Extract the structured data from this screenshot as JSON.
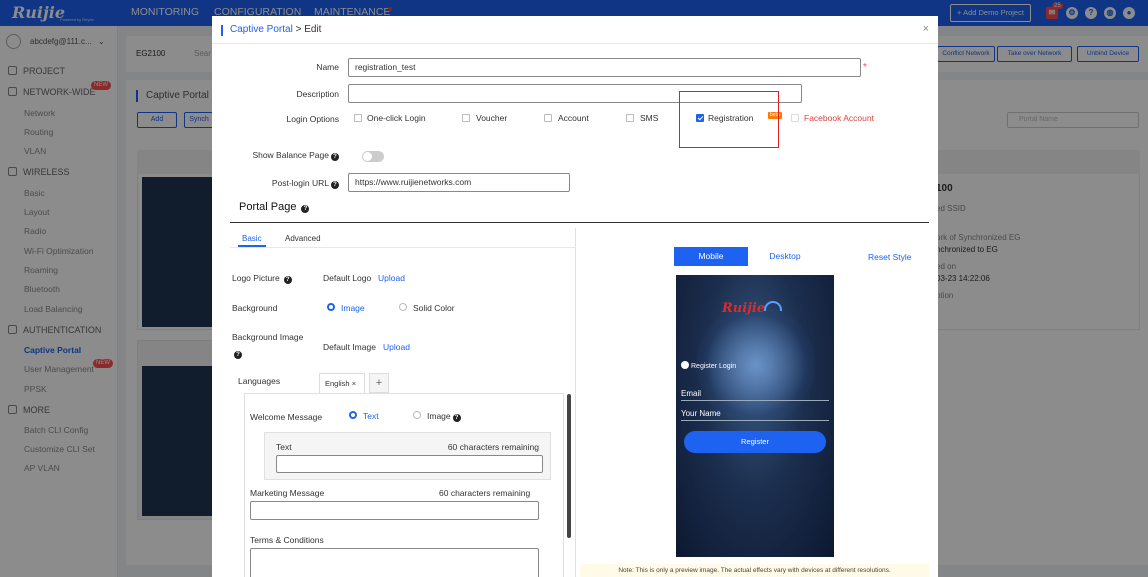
{
  "topbar": {
    "logo": "Ruijie",
    "logo_sub": "Powered by Reyee",
    "nav": [
      "MONITORING",
      "CONFIGURATION",
      "MAINTENANCE"
    ],
    "demo_button": "+ Add Demo Project",
    "notif_count": "25"
  },
  "sidebar": {
    "user": "abcdefg@111.c...",
    "sections": [
      {
        "label": "PROJECT"
      },
      {
        "label": "NETWORK-WIDE",
        "badge": "NEW"
      },
      {
        "label": "WIRELESS"
      },
      {
        "label": "AUTHENTICATION"
      },
      {
        "label": "MORE"
      }
    ],
    "items": [
      "Network",
      "Routing",
      "VLAN",
      "Basic",
      "Layout",
      "Radio",
      "Wi-Fi Optimization",
      "Roaming",
      "Bluetooth",
      "Load Balancing",
      "Captive Portal",
      "User Management",
      "PPSK",
      "Batch CLI Config",
      "Customize CLI Set",
      "AP VLAN"
    ],
    "user_mgmt_badge": "NEW"
  },
  "background": {
    "device": "EG2100",
    "search_stub": "Sear",
    "page_title": "Captive Portal",
    "add_button": "Add",
    "sync_stub": "Synch",
    "header_buttons": [
      "Conflict Network",
      "Take over Network",
      "Unbind Device"
    ],
    "portal_search_placeholder": "Portal Name",
    "card_title_stub": "100",
    "card_lines": [
      "ed SSID",
      "ork of Synchronized EG",
      "nchronized to EG",
      "ed on",
      "03-23 14:22:06",
      "ption"
    ]
  },
  "modal": {
    "breadcrumb": "Captive Portal",
    "title": "Edit",
    "name_label": "Name",
    "name_value": "registration_test",
    "description_label": "Description",
    "description_value": "",
    "login_options_label": "Login Options",
    "login_options": [
      {
        "label": "One-click Login",
        "checked": false
      },
      {
        "label": "Voucher",
        "checked": false
      },
      {
        "label": "Account",
        "checked": false
      },
      {
        "label": "SMS",
        "checked": false
      },
      {
        "label": "Registration",
        "checked": true
      },
      {
        "label": "Facebook Account",
        "checked": false
      }
    ],
    "beta_badge": "beta",
    "show_balance_label": "Show Balance Page",
    "post_login_label": "Post-login URL",
    "post_login_value": "https://www.ruijienetworks.com",
    "portal_page_title": "Portal Page",
    "tabs": [
      "Basic",
      "Advanced"
    ],
    "logo_picture_label": "Logo Picture",
    "default_logo": "Default Logo",
    "upload": "Upload",
    "background_label": "Background",
    "background_options": [
      "Image",
      "Solid Color"
    ],
    "background_image_label": "Background Image",
    "default_image": "Default Image",
    "languages_label": "Languages",
    "language_tab": "English",
    "welcome_label": "Welcome Message",
    "welcome_options": [
      "Text",
      "Image"
    ],
    "text_label": "Text",
    "text_remaining": "60  characters remaining",
    "marketing_label": "Marketing Message",
    "marketing_remaining": "60  characters remaining",
    "terms_label": "Terms & Conditions",
    "preview": {
      "tabs": [
        "Mobile",
        "Desktop"
      ],
      "reset": "Reset Style",
      "logo": "Ruijie",
      "register_login": "Register Login",
      "email": "Email",
      "your_name": "Your Name",
      "register_button": "Register",
      "note": "Note: This is only a preview image. The actual effects vary with devices at different resolutions."
    }
  },
  "colors": {
    "primary": "#1d62f0",
    "danger": "#e02020"
  }
}
